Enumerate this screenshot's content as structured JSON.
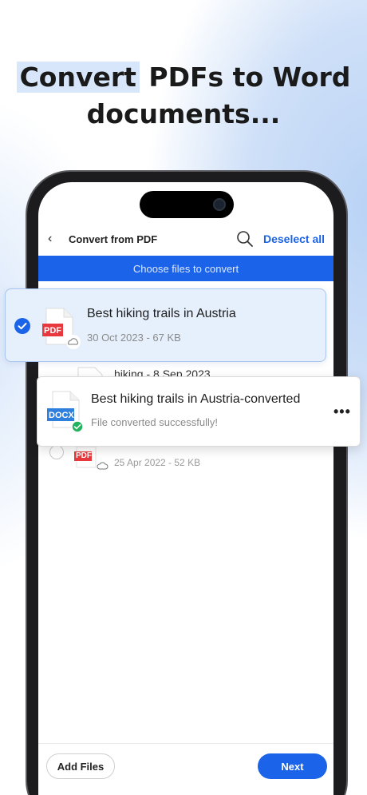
{
  "headline": {
    "highlight": "Convert",
    "rest_line1": " PDFs to Word",
    "line2": "documents..."
  },
  "nav": {
    "back_glyph": "‹",
    "title": "Convert from PDF",
    "deselect_label": "Deselect all"
  },
  "banner": {
    "text": "Choose files to convert"
  },
  "selected_file": {
    "title": "Best hiking trails in Austria",
    "meta": "30 Oct 2023 - 67 KB",
    "badge": "PDF"
  },
  "background_rows": [
    {
      "title": "hiking - 8 Sep 2023"
    },
    {
      "badge": "PDF",
      "meta": "25 Apr 2022 - 52 KB"
    }
  ],
  "converted_file": {
    "title": "Best hiking trails in Austria-converted",
    "status": "File converted successfully!",
    "badge": "DOCX",
    "more_glyph": "•••"
  },
  "footer": {
    "add_files_label": "Add Files",
    "next_label": "Next"
  },
  "colors": {
    "accent": "#1b63e8",
    "pdf": "#e8383d",
    "docx": "#2f7fdc",
    "success": "#22b35e"
  }
}
